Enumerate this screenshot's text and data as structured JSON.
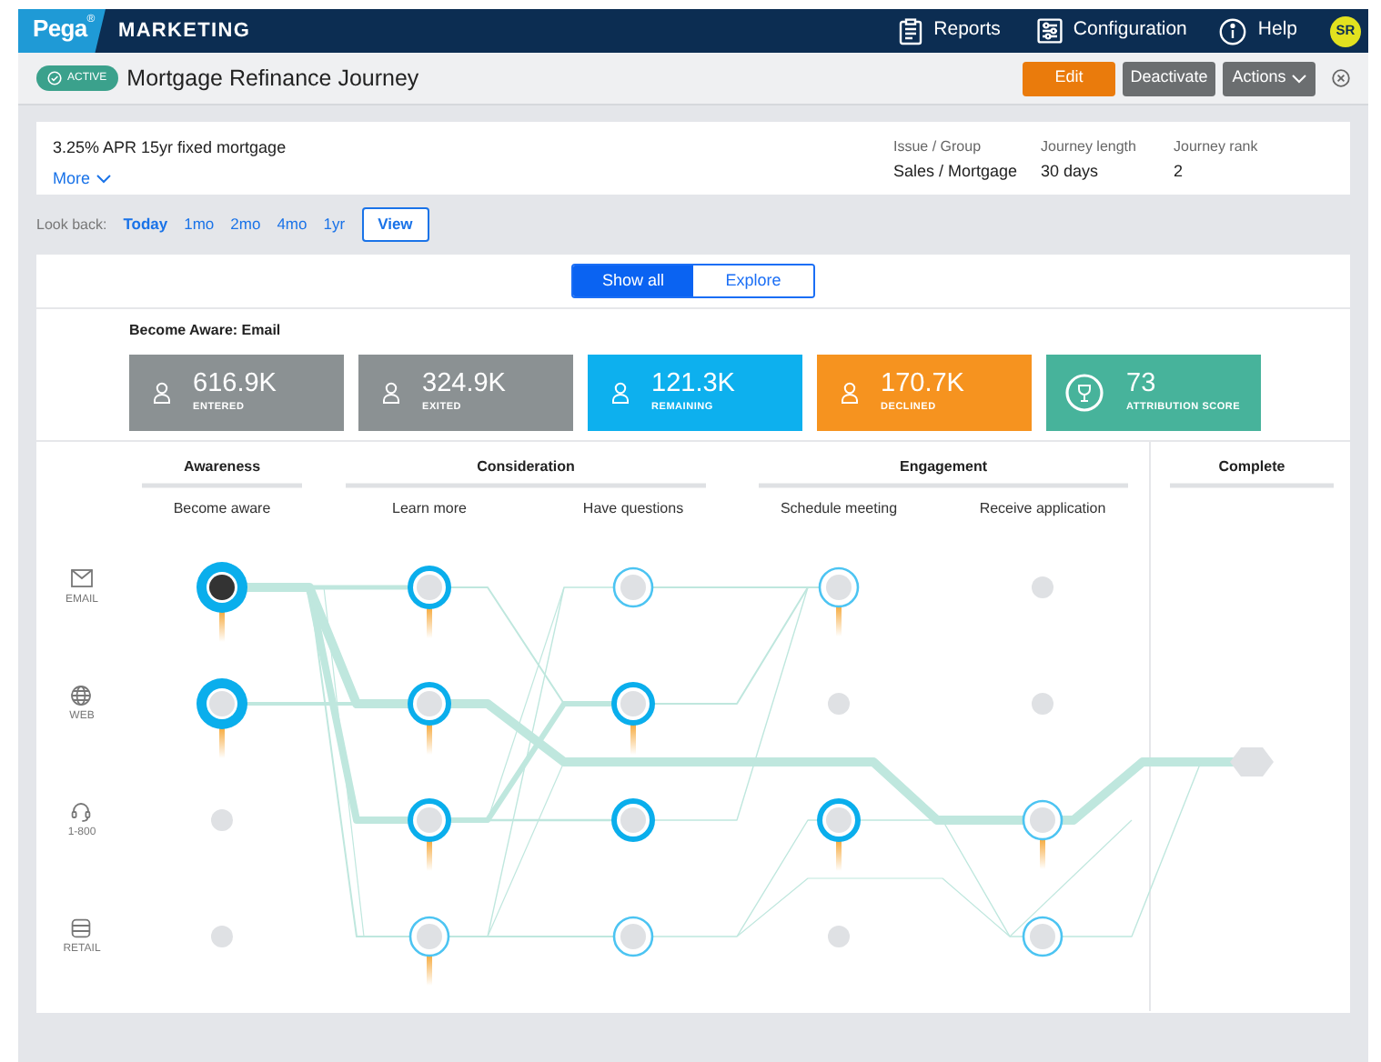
{
  "top_bar": {
    "logo": "Pega",
    "logo_mark": "®",
    "product": "MARKETING",
    "nav": [
      "Reports",
      "Configuration",
      "Help"
    ],
    "avatar": "SR"
  },
  "title_bar": {
    "status": "ACTIVE",
    "title": "Mortgage Refinance Journey",
    "buttons": [
      {
        "label": "Edit",
        "kind": "primary"
      },
      {
        "label": "Deactivate",
        "kind": "secondary"
      },
      {
        "label": "Actions",
        "kind": "menu"
      }
    ]
  },
  "summary": {
    "offer": "3.25% APR 15yr fixed mortgage",
    "more": "More",
    "fields": [
      {
        "label": "Issue / Group",
        "value": "Sales / Mortgage"
      },
      {
        "label": "Journey length",
        "value": "30 days"
      },
      {
        "label": "Journey rank",
        "value": "2"
      }
    ]
  },
  "look_back": {
    "label": "Look back:",
    "options": [
      {
        "label": "Today",
        "selected": true
      },
      {
        "label": "1mo",
        "selected": false
      },
      {
        "label": "2mo",
        "selected": false
      },
      {
        "label": "4mo",
        "selected": false
      },
      {
        "label": "1yr",
        "selected": false
      }
    ],
    "button": "View"
  },
  "view_toggle": [
    {
      "label": "Show all",
      "selected": true
    },
    {
      "label": "Explore",
      "selected": false
    }
  ],
  "metrics_title": "Become Aware: Email",
  "metrics": [
    {
      "value": "616.9K",
      "label": "ENTERED",
      "kind": "count",
      "color": "#8b9193"
    },
    {
      "value": "324.9K",
      "label": "EXITED",
      "kind": "count",
      "color": "#8b9193"
    },
    {
      "value": "121.3K",
      "label": "REMAINING",
      "kind": "count",
      "color": "#0db0ee"
    },
    {
      "value": "170.7K",
      "label": "DECLINED",
      "kind": "count",
      "color": "#f6931f"
    },
    {
      "value": "73",
      "label": "ATTRIBUTION SCORE",
      "kind": "score",
      "color": "#47b39b"
    }
  ],
  "journey_map": {
    "stages": [
      {
        "label": "Awareness",
        "steps": [
          "Become aware"
        ]
      },
      {
        "label": "Consideration",
        "steps": [
          "Learn more",
          "Have questions"
        ]
      },
      {
        "label": "Engagement",
        "steps": [
          "Schedule meeting",
          "Receive application"
        ]
      },
      {
        "label": "Complete"
      }
    ],
    "channels": [
      {
        "label": "EMAIL",
        "kind": "email",
        "nodes": [
          {
            "kind": "large",
            "selected": true,
            "tail": true
          },
          {
            "kind": "ring",
            "selected": false,
            "tail": true
          },
          {
            "kind": "thin",
            "selected": false,
            "tail": false
          },
          {
            "kind": "thin",
            "selected": false,
            "tail": true
          },
          {
            "kind": "dot"
          }
        ]
      },
      {
        "label": "WEB",
        "kind": "web",
        "nodes": [
          {
            "kind": "large",
            "selected": false,
            "tail": true
          },
          {
            "kind": "ring",
            "selected": false,
            "tail": true
          },
          {
            "kind": "ring",
            "selected": false,
            "tail": true
          },
          {
            "kind": "dot"
          },
          {
            "kind": "dot"
          }
        ]
      },
      {
        "label": "1-800",
        "kind": "phone",
        "nodes": [
          {
            "kind": "dot"
          },
          {
            "kind": "ring",
            "selected": false,
            "tail": true
          },
          {
            "kind": "ring",
            "selected": false,
            "tail": false
          },
          {
            "kind": "ring",
            "selected": false,
            "tail": true
          },
          {
            "kind": "thin",
            "selected": false,
            "tail": true
          }
        ]
      },
      {
        "label": "RETAIL",
        "kind": "retail",
        "nodes": [
          {
            "kind": "dot"
          },
          {
            "kind": "thin",
            "selected": false,
            "tail": true
          },
          {
            "kind": "thin",
            "selected": false,
            "tail": false
          },
          {
            "kind": "dot"
          },
          {
            "kind": "thin",
            "selected": false,
            "tail": false
          }
        ]
      }
    ]
  }
}
